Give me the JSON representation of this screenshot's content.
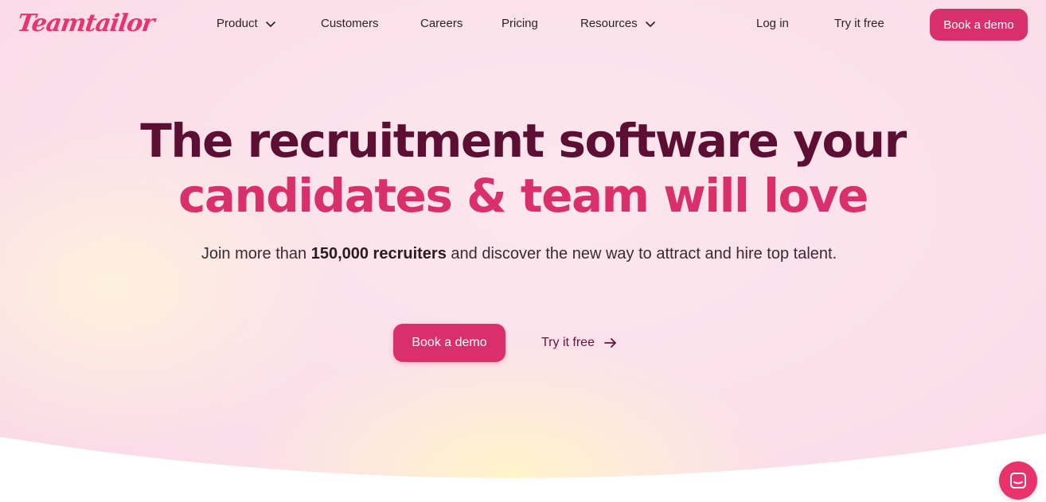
{
  "brand": {
    "logo_text": "Teamtailor",
    "accent": "#d9306b",
    "dark": "#5c0f32"
  },
  "nav": {
    "items": [
      {
        "label": "Product",
        "has_dropdown": true
      },
      {
        "label": "Customers",
        "has_dropdown": false
      },
      {
        "label": "Careers",
        "has_dropdown": false
      },
      {
        "label": "Pricing",
        "has_dropdown": false
      },
      {
        "label": "Resources",
        "has_dropdown": true
      }
    ],
    "login": "Log in",
    "try_free": "Try it free",
    "book_demo": "Book a demo"
  },
  "hero": {
    "title_line1": "The recruitment software your",
    "title_line2": "candidates & team will love",
    "subtitle_pre": "Join more than ",
    "subtitle_bold": "150,000 recruiters",
    "subtitle_post": " and discover the new way to attract and hire top talent.",
    "cta_primary": "Book a demo",
    "cta_secondary": "Try it free"
  },
  "chat": {
    "icon": "chat-icon"
  }
}
